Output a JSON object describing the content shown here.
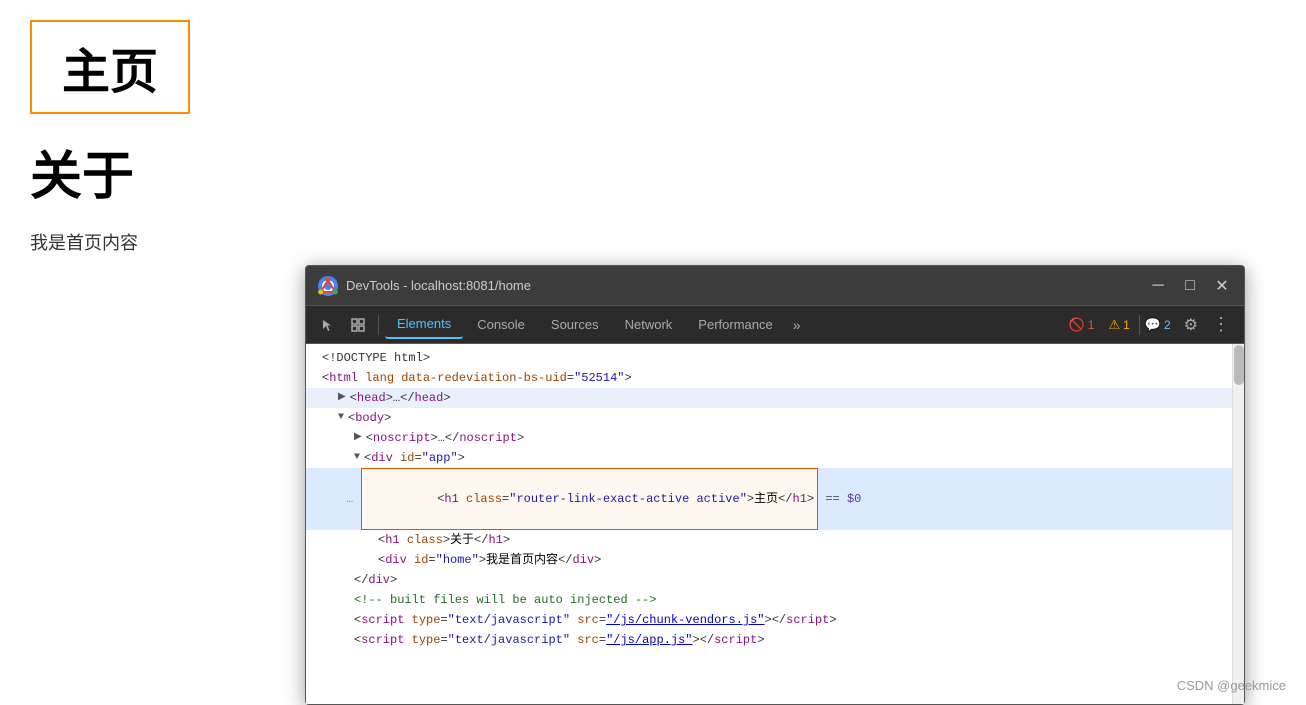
{
  "page": {
    "main_heading": "主页",
    "about_heading": "关于",
    "body_text": "我是首页内容"
  },
  "devtools": {
    "title": "DevTools - localhost:8081/home",
    "tabs": [
      {
        "id": "elements",
        "label": "Elements",
        "active": true
      },
      {
        "id": "console",
        "label": "Console",
        "active": false
      },
      {
        "id": "sources",
        "label": "Sources",
        "active": false
      },
      {
        "id": "network",
        "label": "Network",
        "active": false
      },
      {
        "id": "performance",
        "label": "Performance",
        "active": false
      }
    ],
    "badges": {
      "error_count": "1",
      "warning_count": "1",
      "message_count": "2"
    },
    "code_lines": [
      {
        "indent": 0,
        "content": "<!DOCTYPE html>",
        "type": "doctype"
      },
      {
        "indent": 0,
        "content": "<html lang data-redeviation-bs-uid=\"52514\">",
        "type": "tag"
      },
      {
        "indent": 1,
        "content": "▶<head>…</head>",
        "type": "collapsed",
        "collapsed": true
      },
      {
        "indent": 1,
        "content": "▼<body>",
        "type": "tag",
        "expanded": true
      },
      {
        "indent": 2,
        "content": "▶<noscript>…</noscript>",
        "type": "collapsed"
      },
      {
        "indent": 2,
        "content": "▼<div id=\"app\">",
        "type": "tag",
        "expanded": true
      },
      {
        "indent": 3,
        "content": "<h1 class=\"router-link-exact-active active\">主页</h1> == $0",
        "type": "highlighted-line"
      },
      {
        "indent": 4,
        "content": "<h1 class>关于</h1>",
        "type": "tag"
      },
      {
        "indent": 4,
        "content": "<div id=\"home\">我是首页内容</div>",
        "type": "tag"
      },
      {
        "indent": 3,
        "content": "</div>",
        "type": "tag"
      },
      {
        "indent": 3,
        "content": "<!-- built files will be auto injected -->",
        "type": "comment"
      },
      {
        "indent": 3,
        "content": "<script type=\"text/javascript\" src=\"/js/chunk-vendors.js\"><\\/script>",
        "type": "script-tag"
      },
      {
        "indent": 3,
        "content": "<script type=\"text/javascript\" src=\"/js/app.js\"><\\/script>",
        "type": "script-tag"
      }
    ]
  },
  "watermark": {
    "text": "CSDN @geekmice"
  }
}
